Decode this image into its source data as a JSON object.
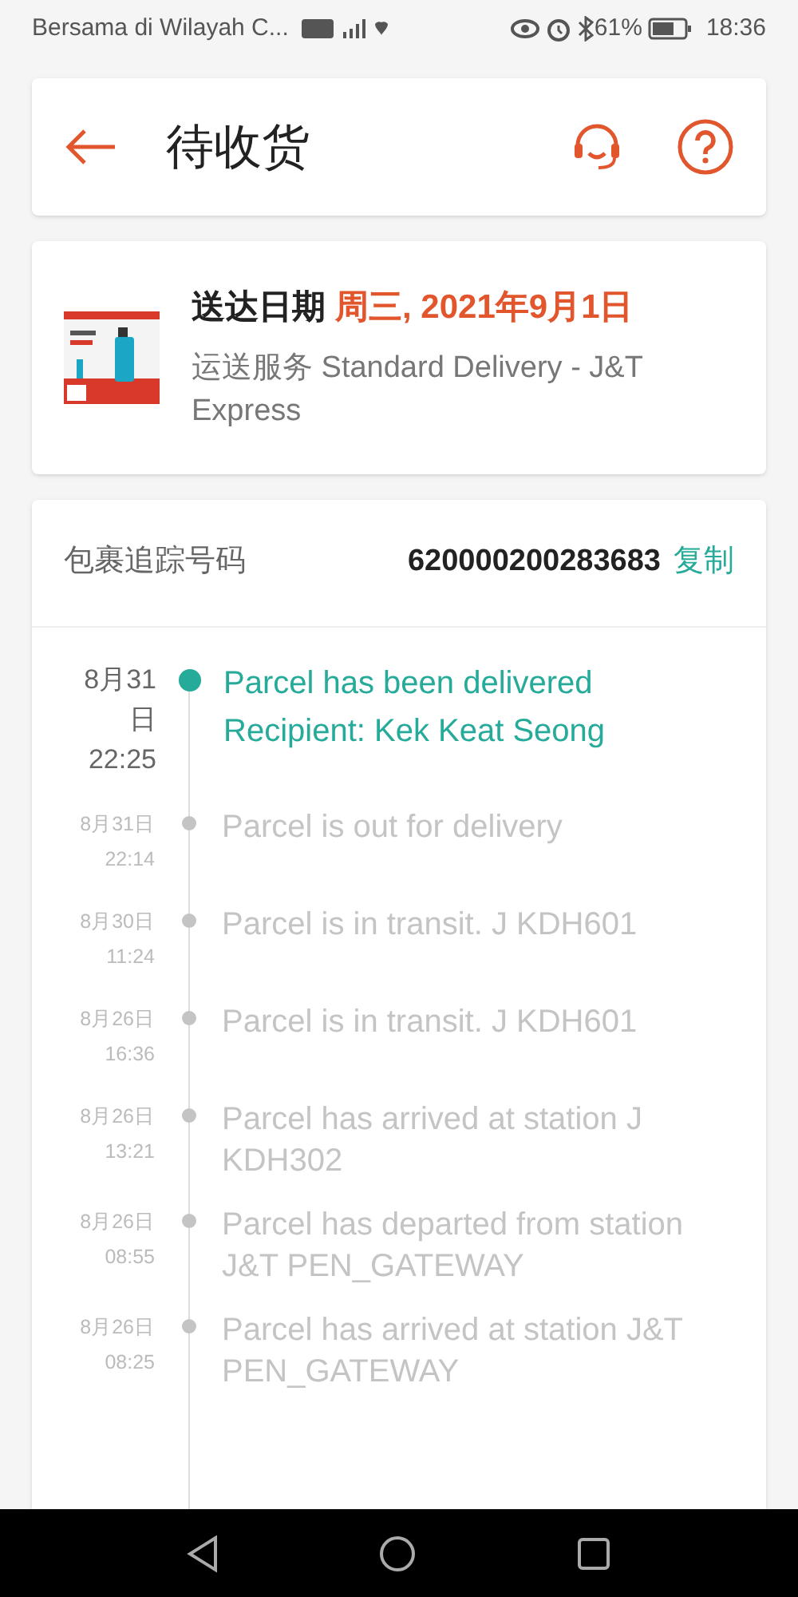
{
  "status_bar": {
    "carrier": "Bersama di Wilayah C...",
    "battery": "61%",
    "time": "18:36"
  },
  "header": {
    "title": "待收货"
  },
  "delivery": {
    "label": "送达日期",
    "date": "周三, 2021年9月1日",
    "service": "运送服务 Standard Delivery  - J&T Express"
  },
  "tracking": {
    "label": "包裹追踪号码",
    "number": "620000200283683",
    "copy": "复制",
    "events": [
      {
        "date": "8月31日",
        "time": "22:25",
        "lines": [
          "Parcel has been delivered",
          "Recipient: Kek Keat Seong"
        ],
        "current": true
      },
      {
        "date": "8月31日",
        "time": "22:14",
        "lines": [
          "Parcel is out for delivery"
        ],
        "current": false
      },
      {
        "date": "8月30日",
        "time": "11:24",
        "lines": [
          "Parcel is in transit. J KDH601"
        ],
        "current": false
      },
      {
        "date": "8月26日",
        "time": "16:36",
        "lines": [
          "Parcel is in transit. J KDH601"
        ],
        "current": false
      },
      {
        "date": "8月26日",
        "time": "13:21",
        "lines": [
          "Parcel has arrived at station J KDH302"
        ],
        "current": false
      },
      {
        "date": "8月26日",
        "time": "08:55",
        "lines": [
          "Parcel has departed from station J&T PEN_GATEWAY"
        ],
        "current": false
      },
      {
        "date": "8月26日",
        "time": "08:25",
        "lines": [
          "Parcel has arrived at station J&T PEN_GATEWAY"
        ],
        "current": false
      }
    ]
  }
}
